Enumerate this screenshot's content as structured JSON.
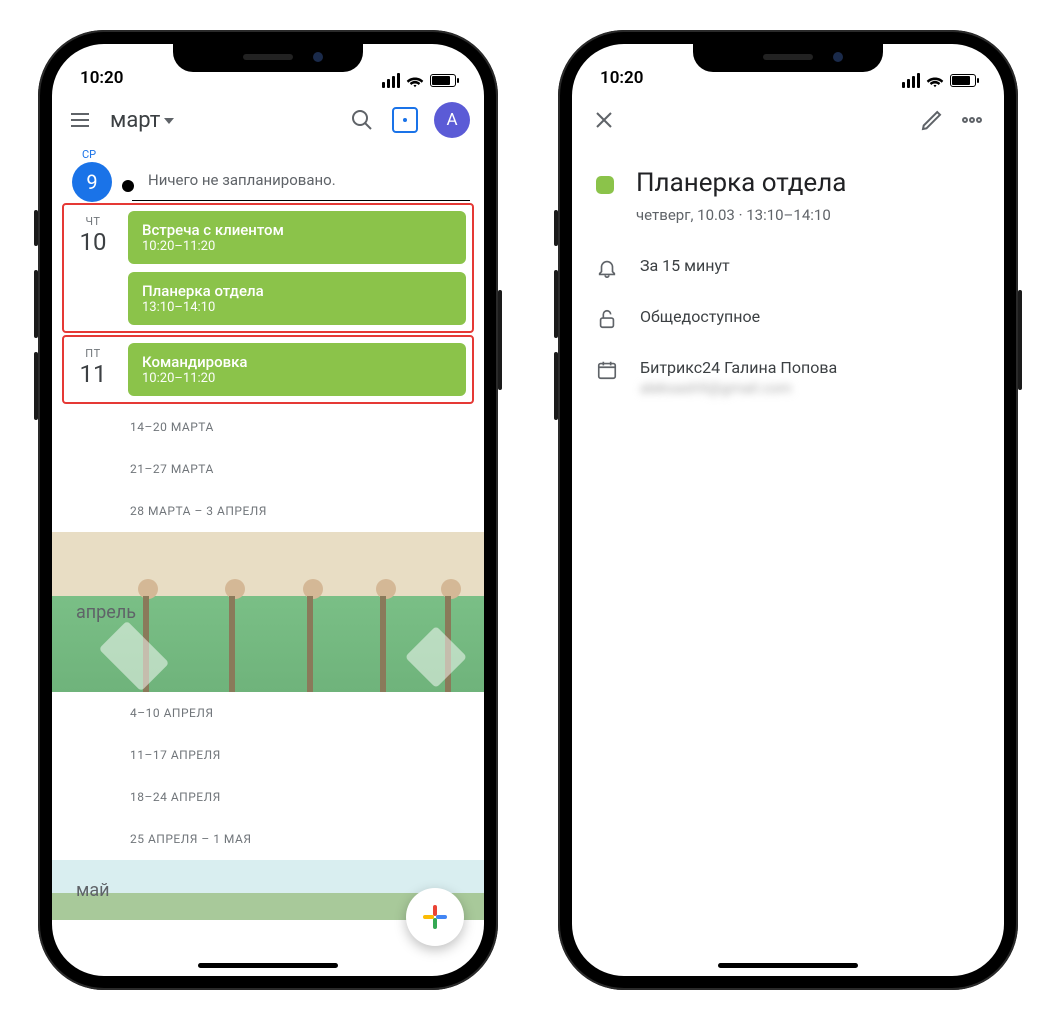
{
  "status": {
    "time": "10:20"
  },
  "left": {
    "header": {
      "month": "март",
      "avatar_initial": "А"
    },
    "today": {
      "dow": "СР",
      "num": "9",
      "text": "Ничего не запланировано."
    },
    "days": [
      {
        "dow": "ЧТ",
        "num": "10",
        "highlighted": true,
        "events": [
          {
            "title": "Встреча с клиентом",
            "time": "10:20–11:20"
          },
          {
            "title": "Планерка отдела",
            "time": "13:10–14:10"
          }
        ]
      },
      {
        "dow": "ПТ",
        "num": "11",
        "highlighted": true,
        "events": [
          {
            "title": "Командировка",
            "time": "10:20–11:20"
          }
        ]
      }
    ],
    "weeks_march": [
      "14–20 МАРТА",
      "21–27 МАРТА",
      "28 МАРТА – 3 АПРЕЛЯ"
    ],
    "month_april": "апрель",
    "weeks_april": [
      "4–10 АПРЕЛЯ",
      "11–17 АПРЕЛЯ",
      "18–24 АПРЕЛЯ",
      "25 АПРЕЛЯ – 1 МАЯ"
    ],
    "month_may": "май"
  },
  "right": {
    "title": "Планерка отдела",
    "subtitle": "четверг, 10.03 · 13:10–14:10",
    "reminder": "За 15 минут",
    "visibility": "Общедоступное",
    "calendar_name": "Битрикс24 Галина Попова",
    "calendar_email": "aleksash9@gmail.com"
  },
  "colors": {
    "event_bg": "#8bc34a",
    "accent": "#1a73e8",
    "highlight_border": "#e53935",
    "avatar_bg": "#5b5bd6"
  }
}
